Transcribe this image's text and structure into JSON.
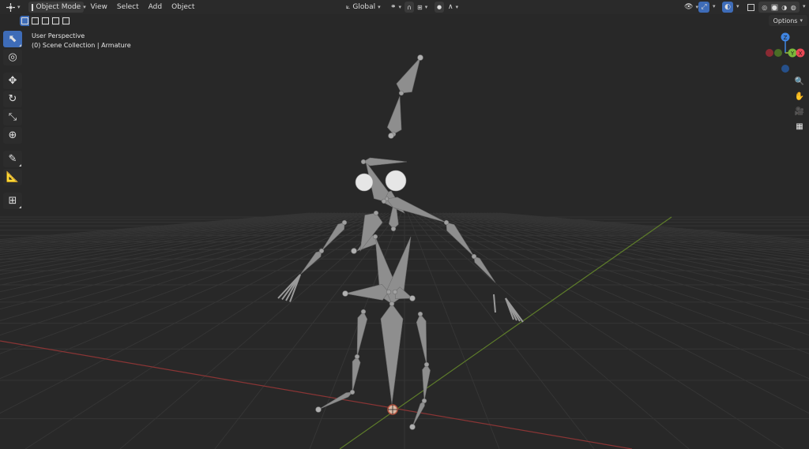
{
  "header": {
    "editor_type_icon": "3d-viewport-icon",
    "mode_label": "Object Mode",
    "menus": [
      "View",
      "Select",
      "Add",
      "Object"
    ],
    "transform_orientation": "Global"
  },
  "overlay": {
    "view_label": "User Perspective",
    "collection_label": "(0) Scene Collection | Armature"
  },
  "options_label": "Options",
  "toolbar": {
    "tools": [
      {
        "name": "select-box-tool-icon",
        "active": true
      },
      {
        "name": "cursor-tool-icon",
        "active": false
      },
      {
        "name": "move-tool-icon",
        "active": false
      },
      {
        "name": "rotate-tool-icon",
        "active": false
      },
      {
        "name": "scale-tool-icon",
        "active": false
      },
      {
        "name": "transform-tool-icon",
        "active": false
      },
      {
        "name": "annotate-tool-icon",
        "active": false
      },
      {
        "name": "measure-tool-icon",
        "active": false
      },
      {
        "name": "add-cube-tool-icon",
        "active": false
      }
    ]
  },
  "gizmo": {
    "axes": [
      "Z",
      "Y",
      "X"
    ],
    "colors": {
      "x": "#e84855",
      "y": "#7ab83a",
      "z": "#3f84e0",
      "x_neg": "#8a2a33",
      "y_neg": "#4a6e26",
      "z_neg": "#26508a"
    }
  },
  "nav_buttons": [
    "zoom-icon",
    "hand-pan-icon",
    "camera-icon",
    "grid-perspective-icon"
  ],
  "colors": {
    "background": "#282828",
    "grid": "#343434",
    "x_axis": "#8a3535",
    "y_axis": "#5e7d2a",
    "bone": "#8f8f8f",
    "accent": "#3e6cb8"
  }
}
